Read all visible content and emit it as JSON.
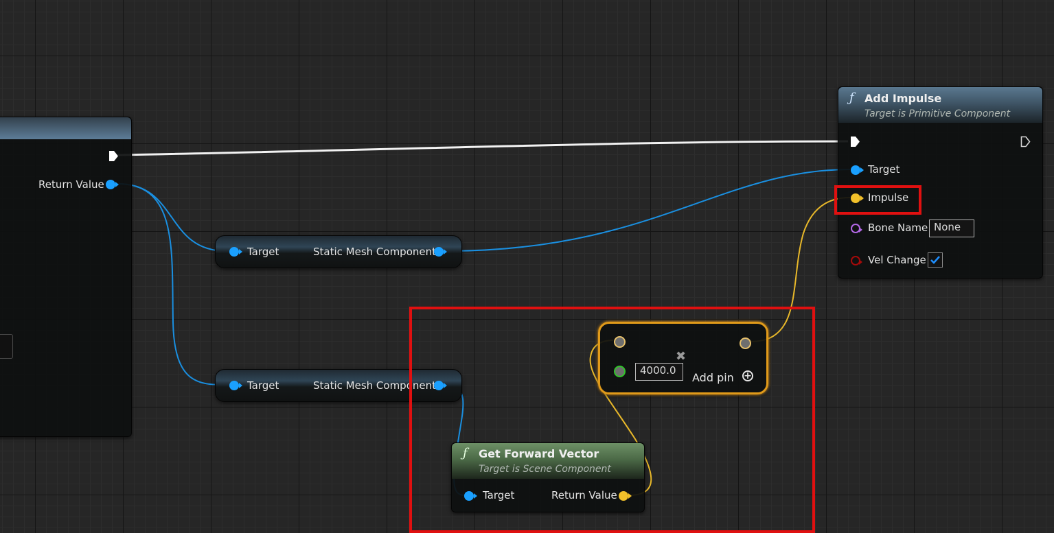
{
  "event_node": {
    "return_value_label": "Return Value"
  },
  "cast_nodes": [
    {
      "target_label": "Target",
      "output_label": "Static Mesh Component"
    },
    {
      "target_label": "Target",
      "output_label": "Static Mesh Component"
    }
  ],
  "add_impulse": {
    "icon": "function-icon",
    "title": "Add Impulse",
    "subtitle": "Target is Primitive Component",
    "pins": {
      "target": "Target",
      "impulse": "Impulse",
      "bone_name": "Bone Name",
      "bone_name_value": "None",
      "vel_change": "Vel Change",
      "vel_change_checked": true
    }
  },
  "multiply_node": {
    "value": "4000.0",
    "add_pin_label": "Add pin",
    "operator_glyph": "✖"
  },
  "get_forward_vector": {
    "icon": "function-icon",
    "title": "Get Forward Vector",
    "subtitle": "Target is Scene Component",
    "target_label": "Target",
    "return_value_label": "Return Value"
  },
  "colors": {
    "exec_wire": "#ffffff",
    "object_wire": "#1aa0ff",
    "vector_wire": "#f1c02a",
    "highlight": "#e01010"
  }
}
